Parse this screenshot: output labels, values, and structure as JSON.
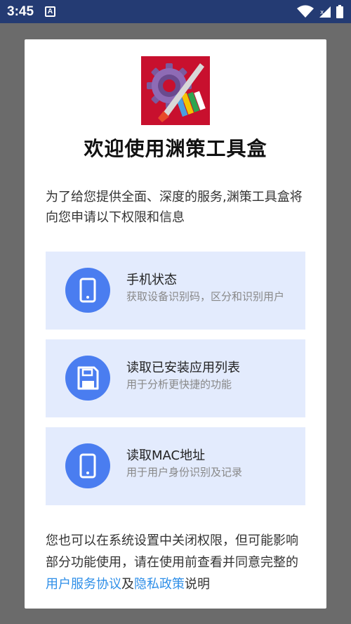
{
  "status_bar": {
    "time": "3:45",
    "app_indicator": "A",
    "icons": [
      "wifi-icon",
      "signal-icon",
      "battery-icon"
    ]
  },
  "dialog": {
    "title": "欢迎使用渊策工具盒",
    "intro": "为了给您提供全面、深度的服务,渊策工具盒将向您申请以下权限和信息",
    "permissions": [
      {
        "title": "手机状态",
        "desc": "获取设备识别码，区分和识别用户",
        "icon": "phone-icon"
      },
      {
        "title": "读取已安装应用列表",
        "desc": "用于分析更快捷的功能",
        "icon": "floppy-disk-icon"
      },
      {
        "title": "读取MAC地址",
        "desc": "用于用户身份识别及记录",
        "icon": "phone-icon"
      }
    ],
    "footer": {
      "text_before": "您也可以在系统设置中关闭权限，但可能影响部分功能使用，请在使用前查看并同意完整的",
      "user_agreement_link": "用户服务协议",
      "conjunction": "及",
      "privacy_link": "隐私政策",
      "text_after": "说明"
    }
  },
  "colors": {
    "status_bar": "#243b73",
    "backdrop": "#6b6b6b",
    "card_bg": "#e3ebfd",
    "icon_circle": "#4a7df0",
    "link": "#2f8fe8",
    "logo_bg": "#c8102e"
  }
}
